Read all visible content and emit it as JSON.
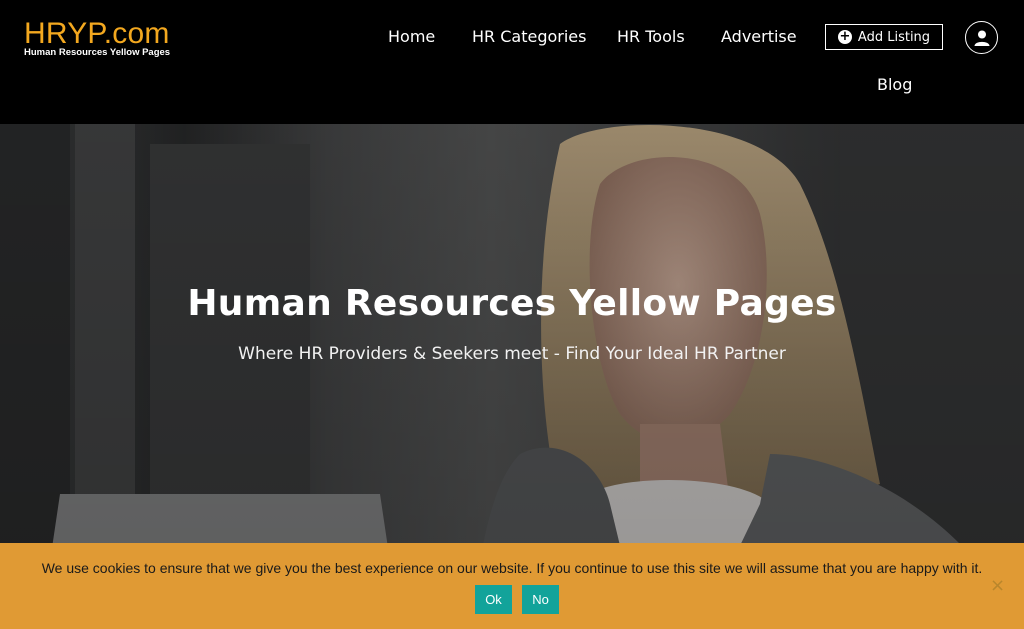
{
  "logo": {
    "main": "HRYP.com",
    "sub": "Human Resources Yellow Pages"
  },
  "nav": {
    "home": "Home",
    "categories": "HR Categories",
    "tools": "HR Tools",
    "advertise": "Advertise",
    "blog": "Blog",
    "add_listing": "Add Listing"
  },
  "icons": {
    "add": "plus-circle-icon",
    "account": "user-account-icon",
    "close": "close-icon"
  },
  "hero": {
    "title": "Human Resources Yellow Pages",
    "subtitle": "Where HR Providers & Seekers meet - Find Your Ideal HR Partner"
  },
  "cookie": {
    "message": "We use cookies to ensure that we give you the best experience on our website. If you continue to use this site we will assume that you are happy with it.",
    "ok": "Ok",
    "no": "No",
    "close": "×"
  },
  "colors": {
    "brand": "#f3a81f",
    "cookie_bg": "#e09a34",
    "cookie_button": "#12a39a",
    "header_bg": "#000000"
  }
}
